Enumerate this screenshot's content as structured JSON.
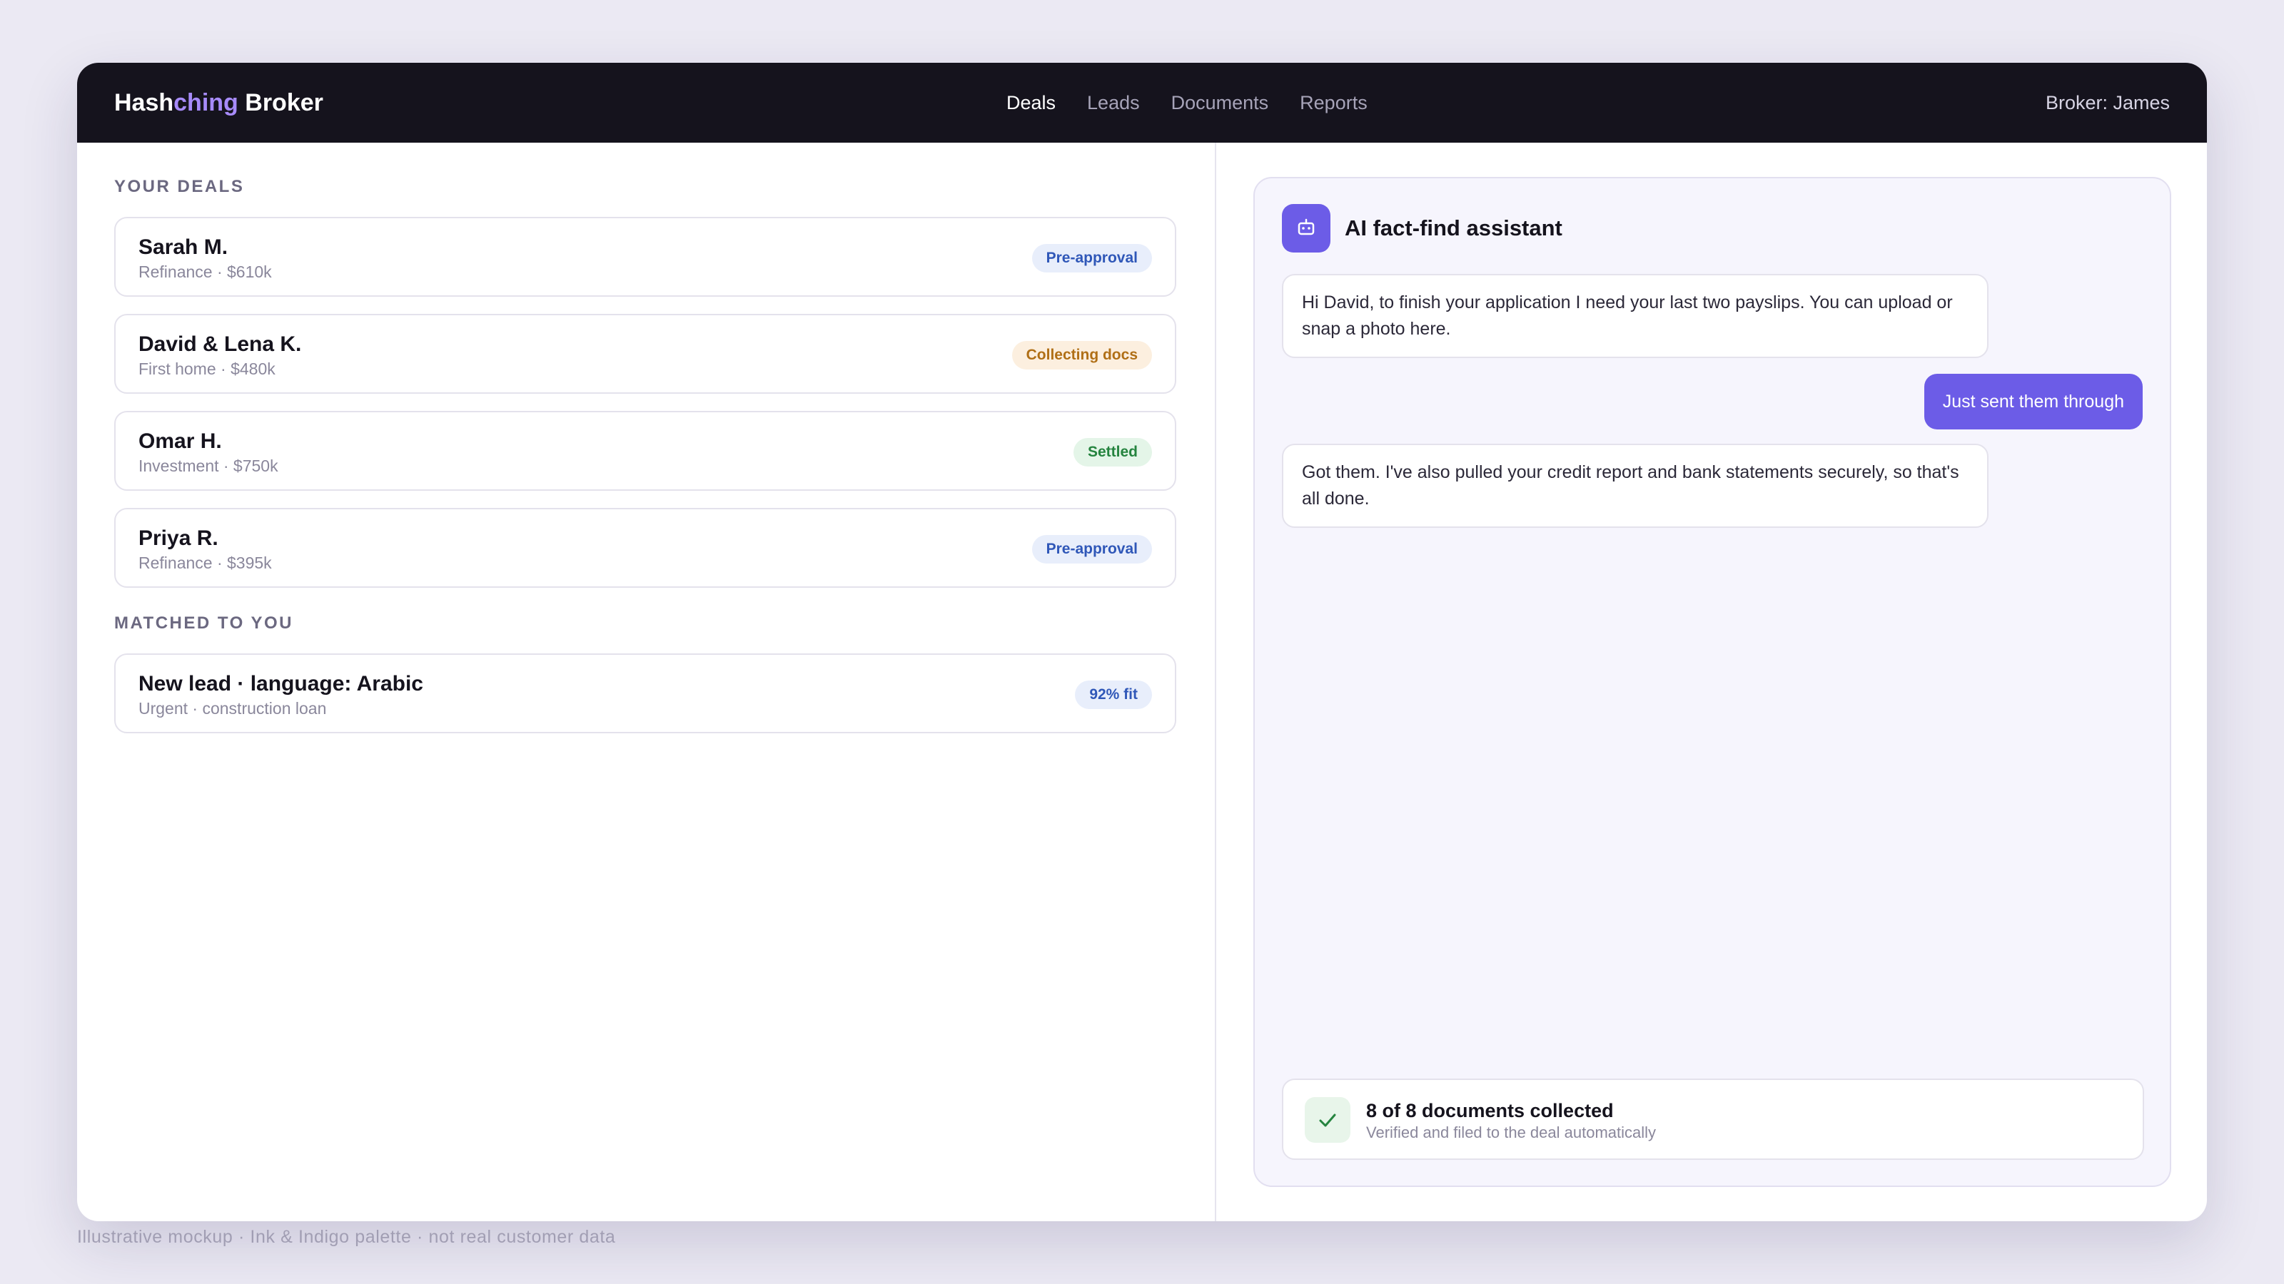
{
  "app": {
    "brand_part1": "Hash",
    "brand_part2": "ching",
    "brand_part3": " Broker",
    "broker_label": "Broker: James"
  },
  "nav": {
    "items": [
      "Deals",
      "Leads",
      "Documents",
      "Reports"
    ],
    "active": "Deals"
  },
  "deals": {
    "section_label": "YOUR DEALS",
    "items": [
      {
        "name": "Sarah M.",
        "detail": "Refinance · $610k",
        "status": "Pre-approval"
      },
      {
        "name": "David & Lena K.",
        "detail": "First home · $480k",
        "status": "Collecting docs"
      },
      {
        "name": "Omar H.",
        "detail": "Investment · $750k",
        "status": "Settled"
      },
      {
        "name": "Priya R.",
        "detail": "Refinance · $395k",
        "status": "Pre-approval"
      }
    ]
  },
  "matched": {
    "section_label": "MATCHED TO YOU",
    "items": [
      {
        "name": "New lead · language: Arabic",
        "detail": "Urgent · construction loan",
        "status": "92% fit"
      }
    ]
  },
  "assistant": {
    "title": "AI fact-find assistant",
    "icon": "robot-icon",
    "messages": [
      {
        "from": "ai",
        "text": "Hi David, to finish your application I need your last two payslips. You can upload or snap a photo here."
      },
      {
        "from": "user",
        "text": "Just sent them through"
      },
      {
        "from": "ai",
        "text": "Got them. I've also pulled your credit report and bank statements securely, so that's all done."
      }
    ],
    "status": {
      "icon": "checkmark-icon",
      "title": "8 of 8 documents collected",
      "subtitle": "Verified and filed to the deal automatically"
    }
  },
  "footer": {
    "note": "Illustrative mockup · Ink & Indigo palette · not real customer data"
  },
  "colors": {
    "topbar": "#15131d",
    "accent": "#6c5ce7",
    "brand_accent": "#a78bfa",
    "badge_blue": "#2f57b8",
    "badge_orange": "#b06f16",
    "badge_green": "#25843f"
  }
}
